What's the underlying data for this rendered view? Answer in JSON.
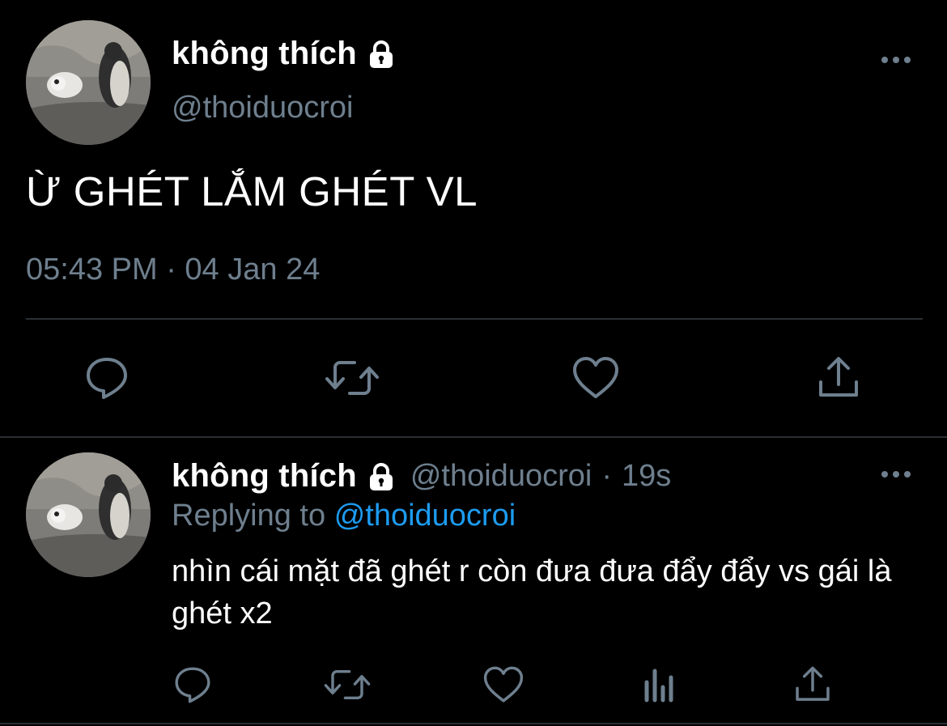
{
  "main_tweet": {
    "display_name": "không thích",
    "handle": "@thoiduocroi",
    "text": "Ừ GHÉT LẮM GHÉT VL",
    "timestamp": "05:43 PM · 04 Jan 24",
    "avatar_icon": "penguin-avatar",
    "actions": [
      "reply-icon",
      "retweet-icon",
      "like-icon",
      "share-icon"
    ]
  },
  "reply_tweet": {
    "display_name": "không thích",
    "handle": "@thoiduocroi",
    "separator": "·",
    "time_ago": "19s",
    "replying_label": "Replying to",
    "replying_to": "@thoiduocroi",
    "text": "nhìn cái mặt đã ghét r còn đưa đưa đẩy đẩy vs gái là ghét x2",
    "avatar_icon": "penguin-avatar",
    "actions": [
      "reply-icon",
      "retweet-icon",
      "like-icon",
      "analytics-icon",
      "share-icon"
    ]
  },
  "colors": {
    "background": "#000000",
    "text_primary": "#ffffff",
    "text_secondary": "#6e7f8e",
    "link": "#1d9bf0",
    "divider": "#2a2f34"
  }
}
